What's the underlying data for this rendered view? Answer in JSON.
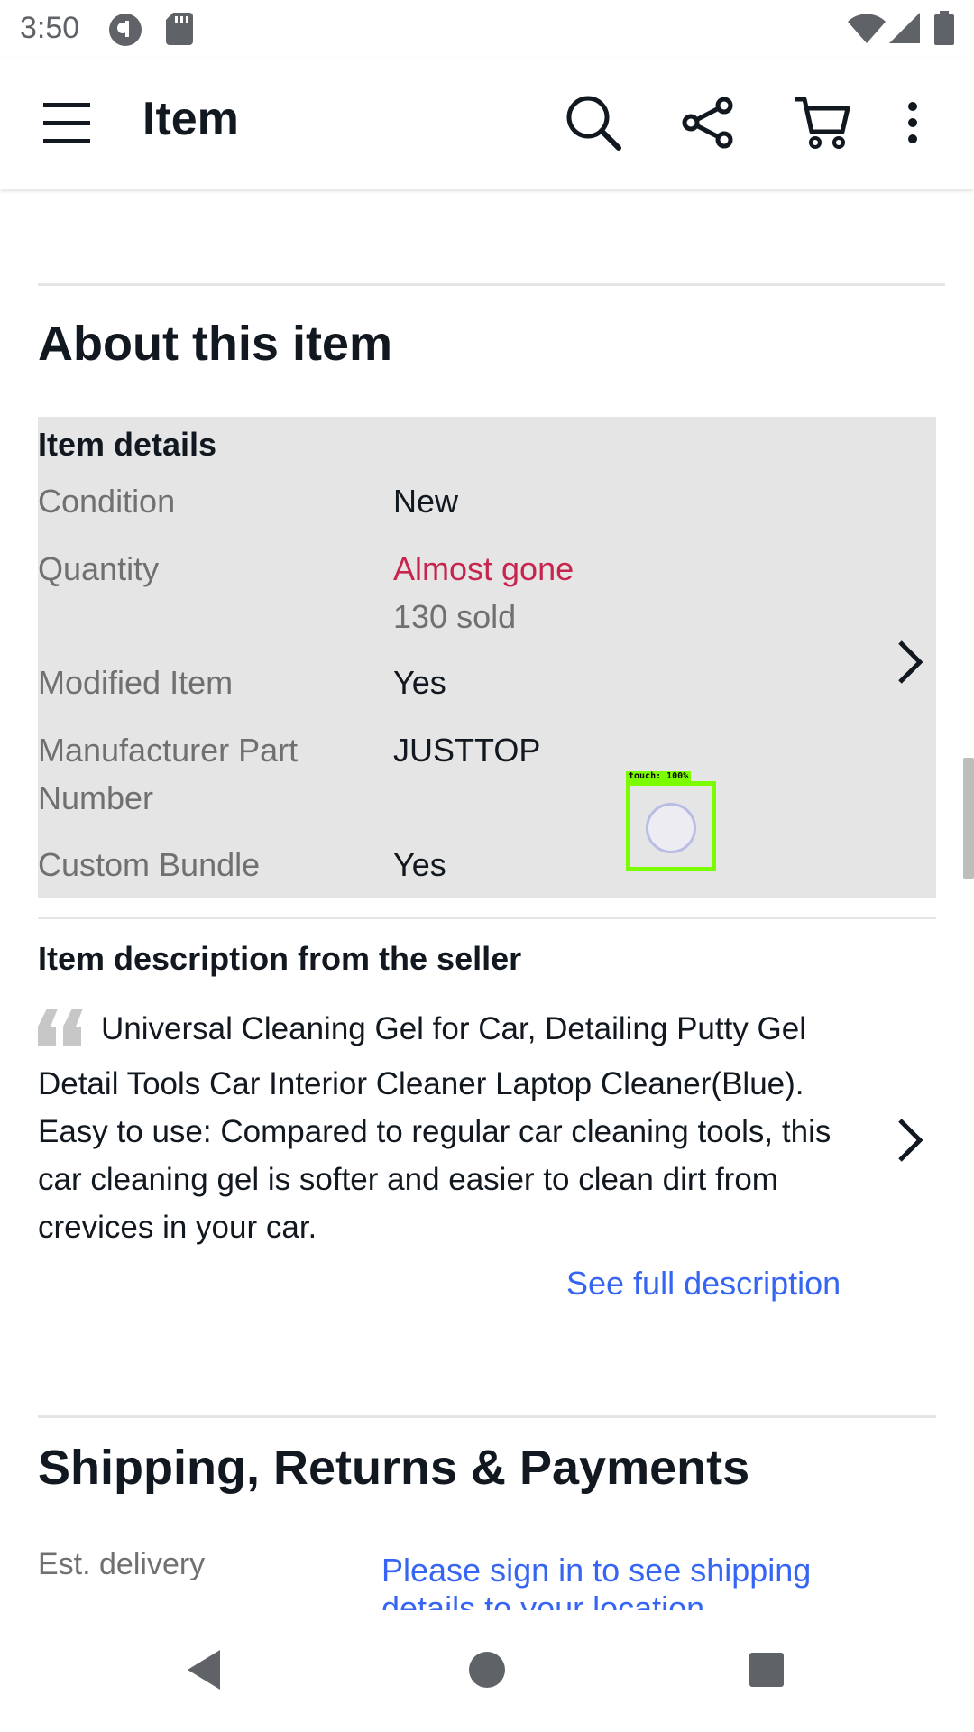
{
  "status_bar": {
    "time": "3:50"
  },
  "app_bar": {
    "title": "Item",
    "icons": [
      "menu-icon",
      "search-icon",
      "share-icon",
      "cart-icon",
      "more-icon"
    ]
  },
  "about": {
    "title": "About this item",
    "details_heading": "Item details",
    "rows": [
      {
        "label": "Condition",
        "value": "New"
      },
      {
        "label": "Quantity",
        "value": "Almost gone",
        "sub_value": "130 sold"
      },
      {
        "label": "Modified Item",
        "value": "Yes"
      },
      {
        "label": "Manufacturer Part Number",
        "value": "JUSTTOP"
      },
      {
        "label": "Custom Bundle",
        "value": "Yes"
      }
    ]
  },
  "description": {
    "heading": "Item description from the seller",
    "text": "Universal Cleaning Gel for Car, Detailing Putty Gel Detail Tools Car Interior Cleaner Laptop Cleaner(Blue). Easy to use: Compared to regular car cleaning tools, this car cleaning gel is softer and easier to clean dirt from crevices in your car.",
    "see_full": "See full description"
  },
  "shipping": {
    "title": "Shipping, Returns & Payments",
    "est_delivery_label": "Est. delivery",
    "sign_in_link": "Please sign in to see shipping details to your location"
  },
  "touch_overlay": {
    "label": "touch: 100%"
  },
  "colors": {
    "link": "#3665f3",
    "alert": "#c7254e",
    "panel": "#e5e5e5"
  }
}
